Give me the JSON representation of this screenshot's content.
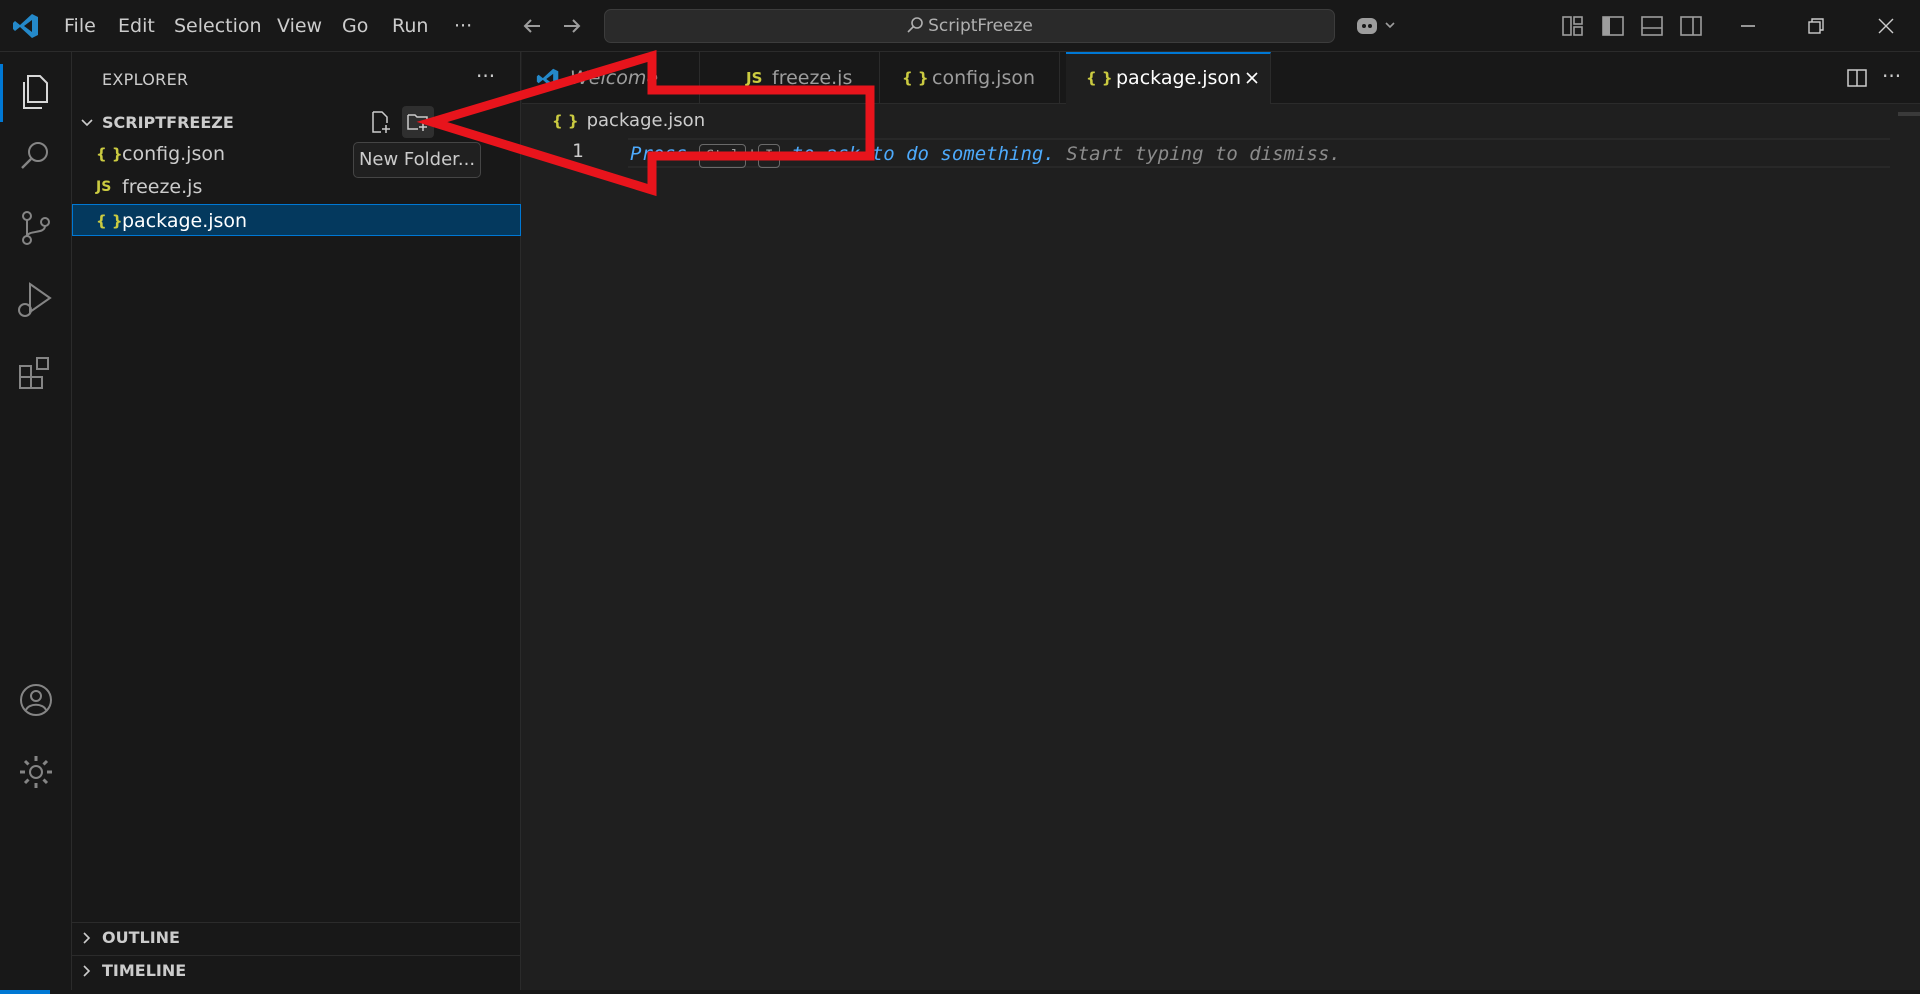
{
  "menu": {
    "items": [
      "File",
      "Edit",
      "Selection",
      "View",
      "Go",
      "Run"
    ],
    "more": "···"
  },
  "title_search": "ScriptFreeze",
  "sidebar": {
    "title": "EXPLORER",
    "more": "···",
    "folder": "SCRIPTFREEZE",
    "files": [
      {
        "name": "config.json",
        "glyph": "{ }"
      },
      {
        "name": "freeze.js",
        "glyph": "JS"
      },
      {
        "name": "package.json",
        "glyph": "{ }"
      }
    ],
    "tooltip": "New Folder...",
    "outline": "OUTLINE",
    "timeline": "TIMELINE"
  },
  "tabs": [
    {
      "label": "Welcome",
      "glyph": ""
    },
    {
      "label": "freeze.js",
      "glyph": "JS"
    },
    {
      "label": "config.json",
      "glyph": "{ }"
    },
    {
      "label": "package.json",
      "glyph": "{ }"
    }
  ],
  "editor": {
    "breadcrumb": "package.json",
    "breadcrumb_glyph": "{ }",
    "line_number": "1",
    "hint_press": "Press",
    "hint_key1": "Ctrl",
    "hint_plus": "+",
    "hint_key2": "I",
    "hint_link": "to ask to do something.",
    "hint_rest": "Start typing to dismiss."
  },
  "colors": {
    "accent": "#0078d4",
    "annotation_arrow": "#e8141c",
    "json_icon": "#cbcb41"
  }
}
